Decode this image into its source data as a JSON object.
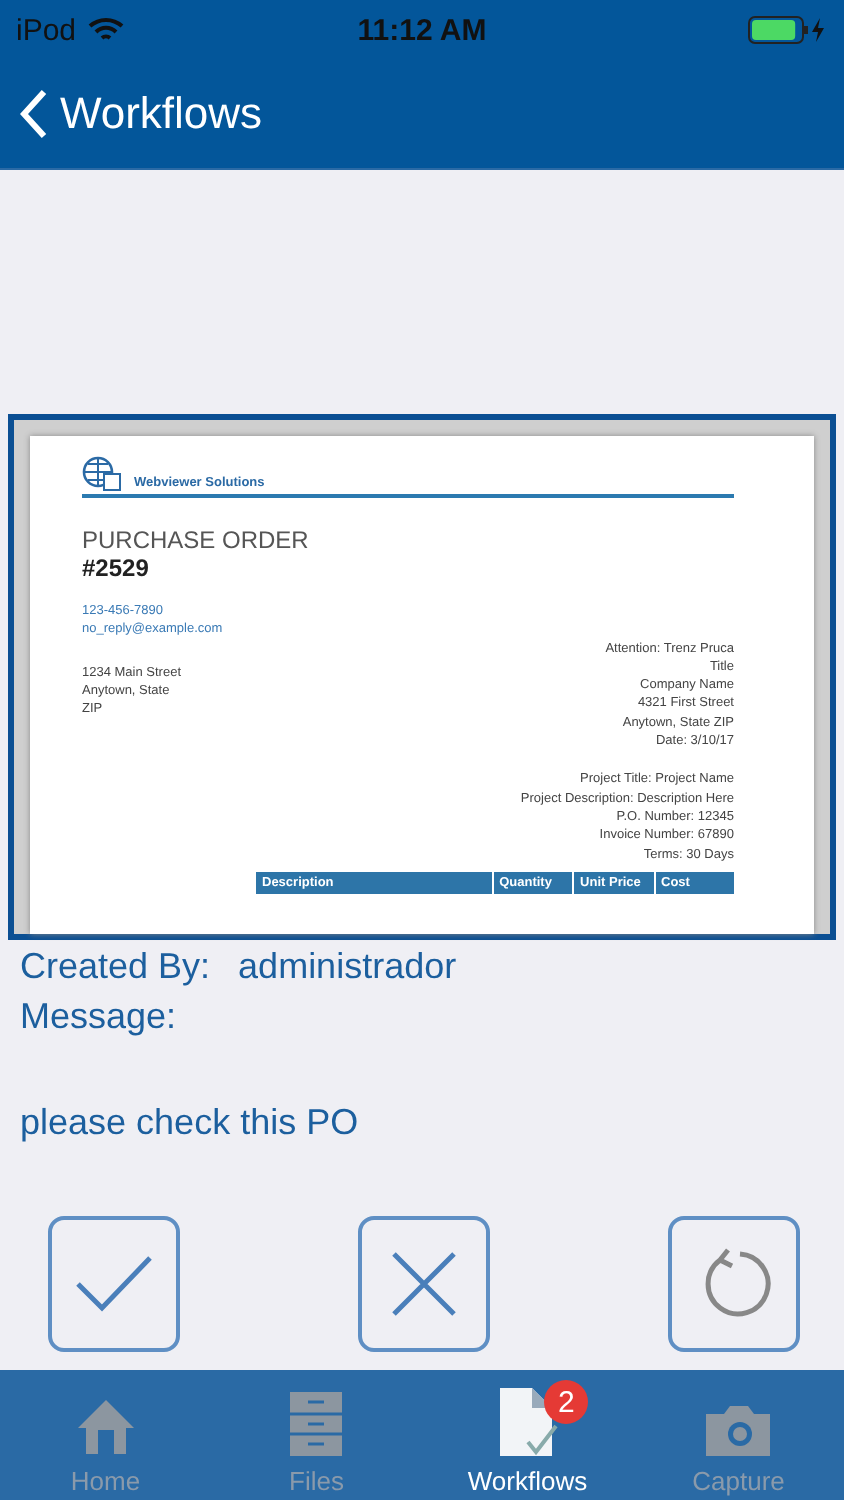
{
  "status_bar": {
    "carrier": "iPod",
    "time": "11:12 AM",
    "battery": {
      "level": 0.9
    }
  },
  "nav": {
    "back_label": "Workflows"
  },
  "document": {
    "company": "Webviewer Solutions",
    "title": "PURCHASE ORDER",
    "number": "#2529",
    "contact": [
      "123-456-7890",
      "no_reply@example.com"
    ],
    "address": [
      "1234 Main Street",
      "Anytown, State",
      "ZIP"
    ],
    "recipient": [
      "Attention: Trenz Pruca",
      "Title",
      "Company Name",
      "4321 First Street",
      "Anytown, State ZIP",
      "Date: 3/10/17"
    ],
    "project": [
      "Project Title: Project Name",
      "Project Description: Description Here",
      "P.O. Number: 12345",
      "Invoice Number: 67890",
      "Terms: 30 Days"
    ],
    "table_columns": [
      "Description",
      "Quantity",
      "Unit Price",
      "Cost"
    ]
  },
  "details": {
    "created_by_label": "Created By:",
    "created_by": "administrador",
    "message_label": "Message:",
    "message": "please check this PO"
  },
  "actions": [
    {
      "kind": "approve"
    },
    {
      "kind": "reject"
    },
    {
      "kind": "reset"
    }
  ],
  "tabs": [
    {
      "label": "Home",
      "kind": "home",
      "selected": false
    },
    {
      "label": "Files",
      "kind": "cabinet",
      "selected": false
    },
    {
      "label": "Workflows",
      "kind": "document",
      "selected": true,
      "badge": "2"
    },
    {
      "label": "Capture",
      "kind": "camera",
      "selected": false
    }
  ]
}
